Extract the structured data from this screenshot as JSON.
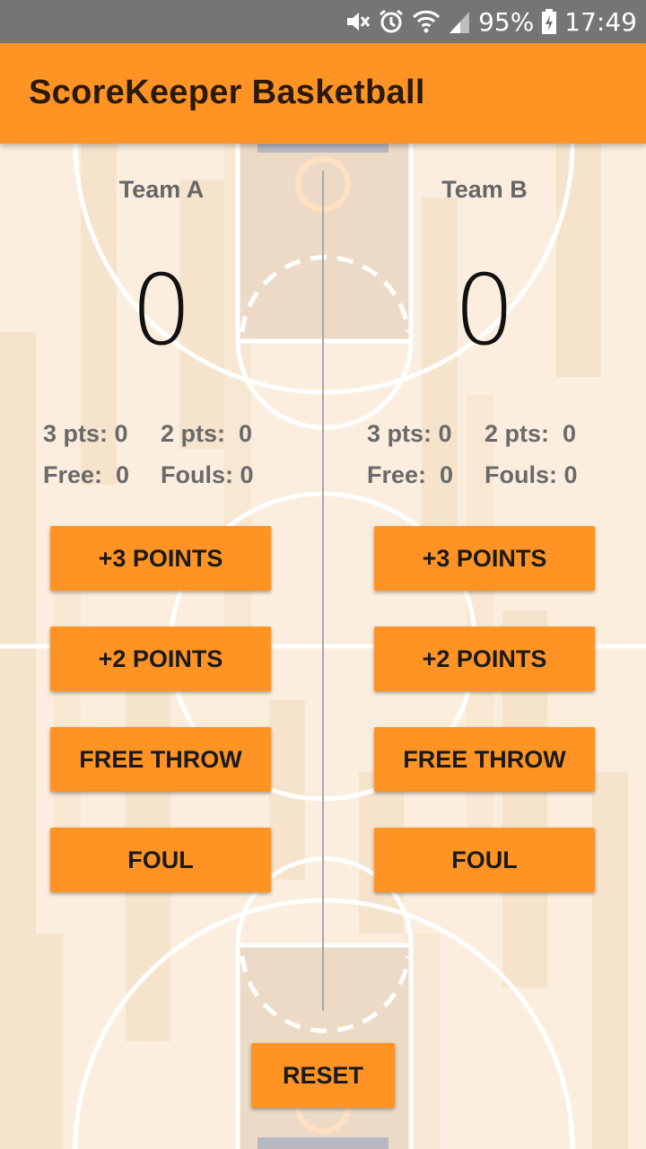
{
  "status_bar": {
    "battery": "95%",
    "time": "17:49",
    "icons": [
      "mute-icon",
      "alarm-icon",
      "wifi-icon",
      "signal-icon",
      "battery-charging-icon"
    ]
  },
  "app_bar": {
    "title": "ScoreKeeper Basketball"
  },
  "colors": {
    "accent": "#ff9424",
    "status_bar": "#757575",
    "court_light": "#fbeede"
  },
  "team_a": {
    "name": "Team A",
    "score": "0",
    "three_pts": "3 pts: 0",
    "two_pts": "2 pts:  0",
    "free": "Free:  0",
    "fouls": "Fouls: 0"
  },
  "team_b": {
    "name": "Team B",
    "score": "0",
    "three_pts": "3 pts: 0",
    "two_pts": "2 pts:  0",
    "free": "Free:  0",
    "fouls": "Fouls: 0"
  },
  "buttons": {
    "three_points": "+3 POINTS",
    "two_points": "+2 POINTS",
    "free_throw": "FREE THROW",
    "foul": "FOUL",
    "reset": "RESET"
  }
}
